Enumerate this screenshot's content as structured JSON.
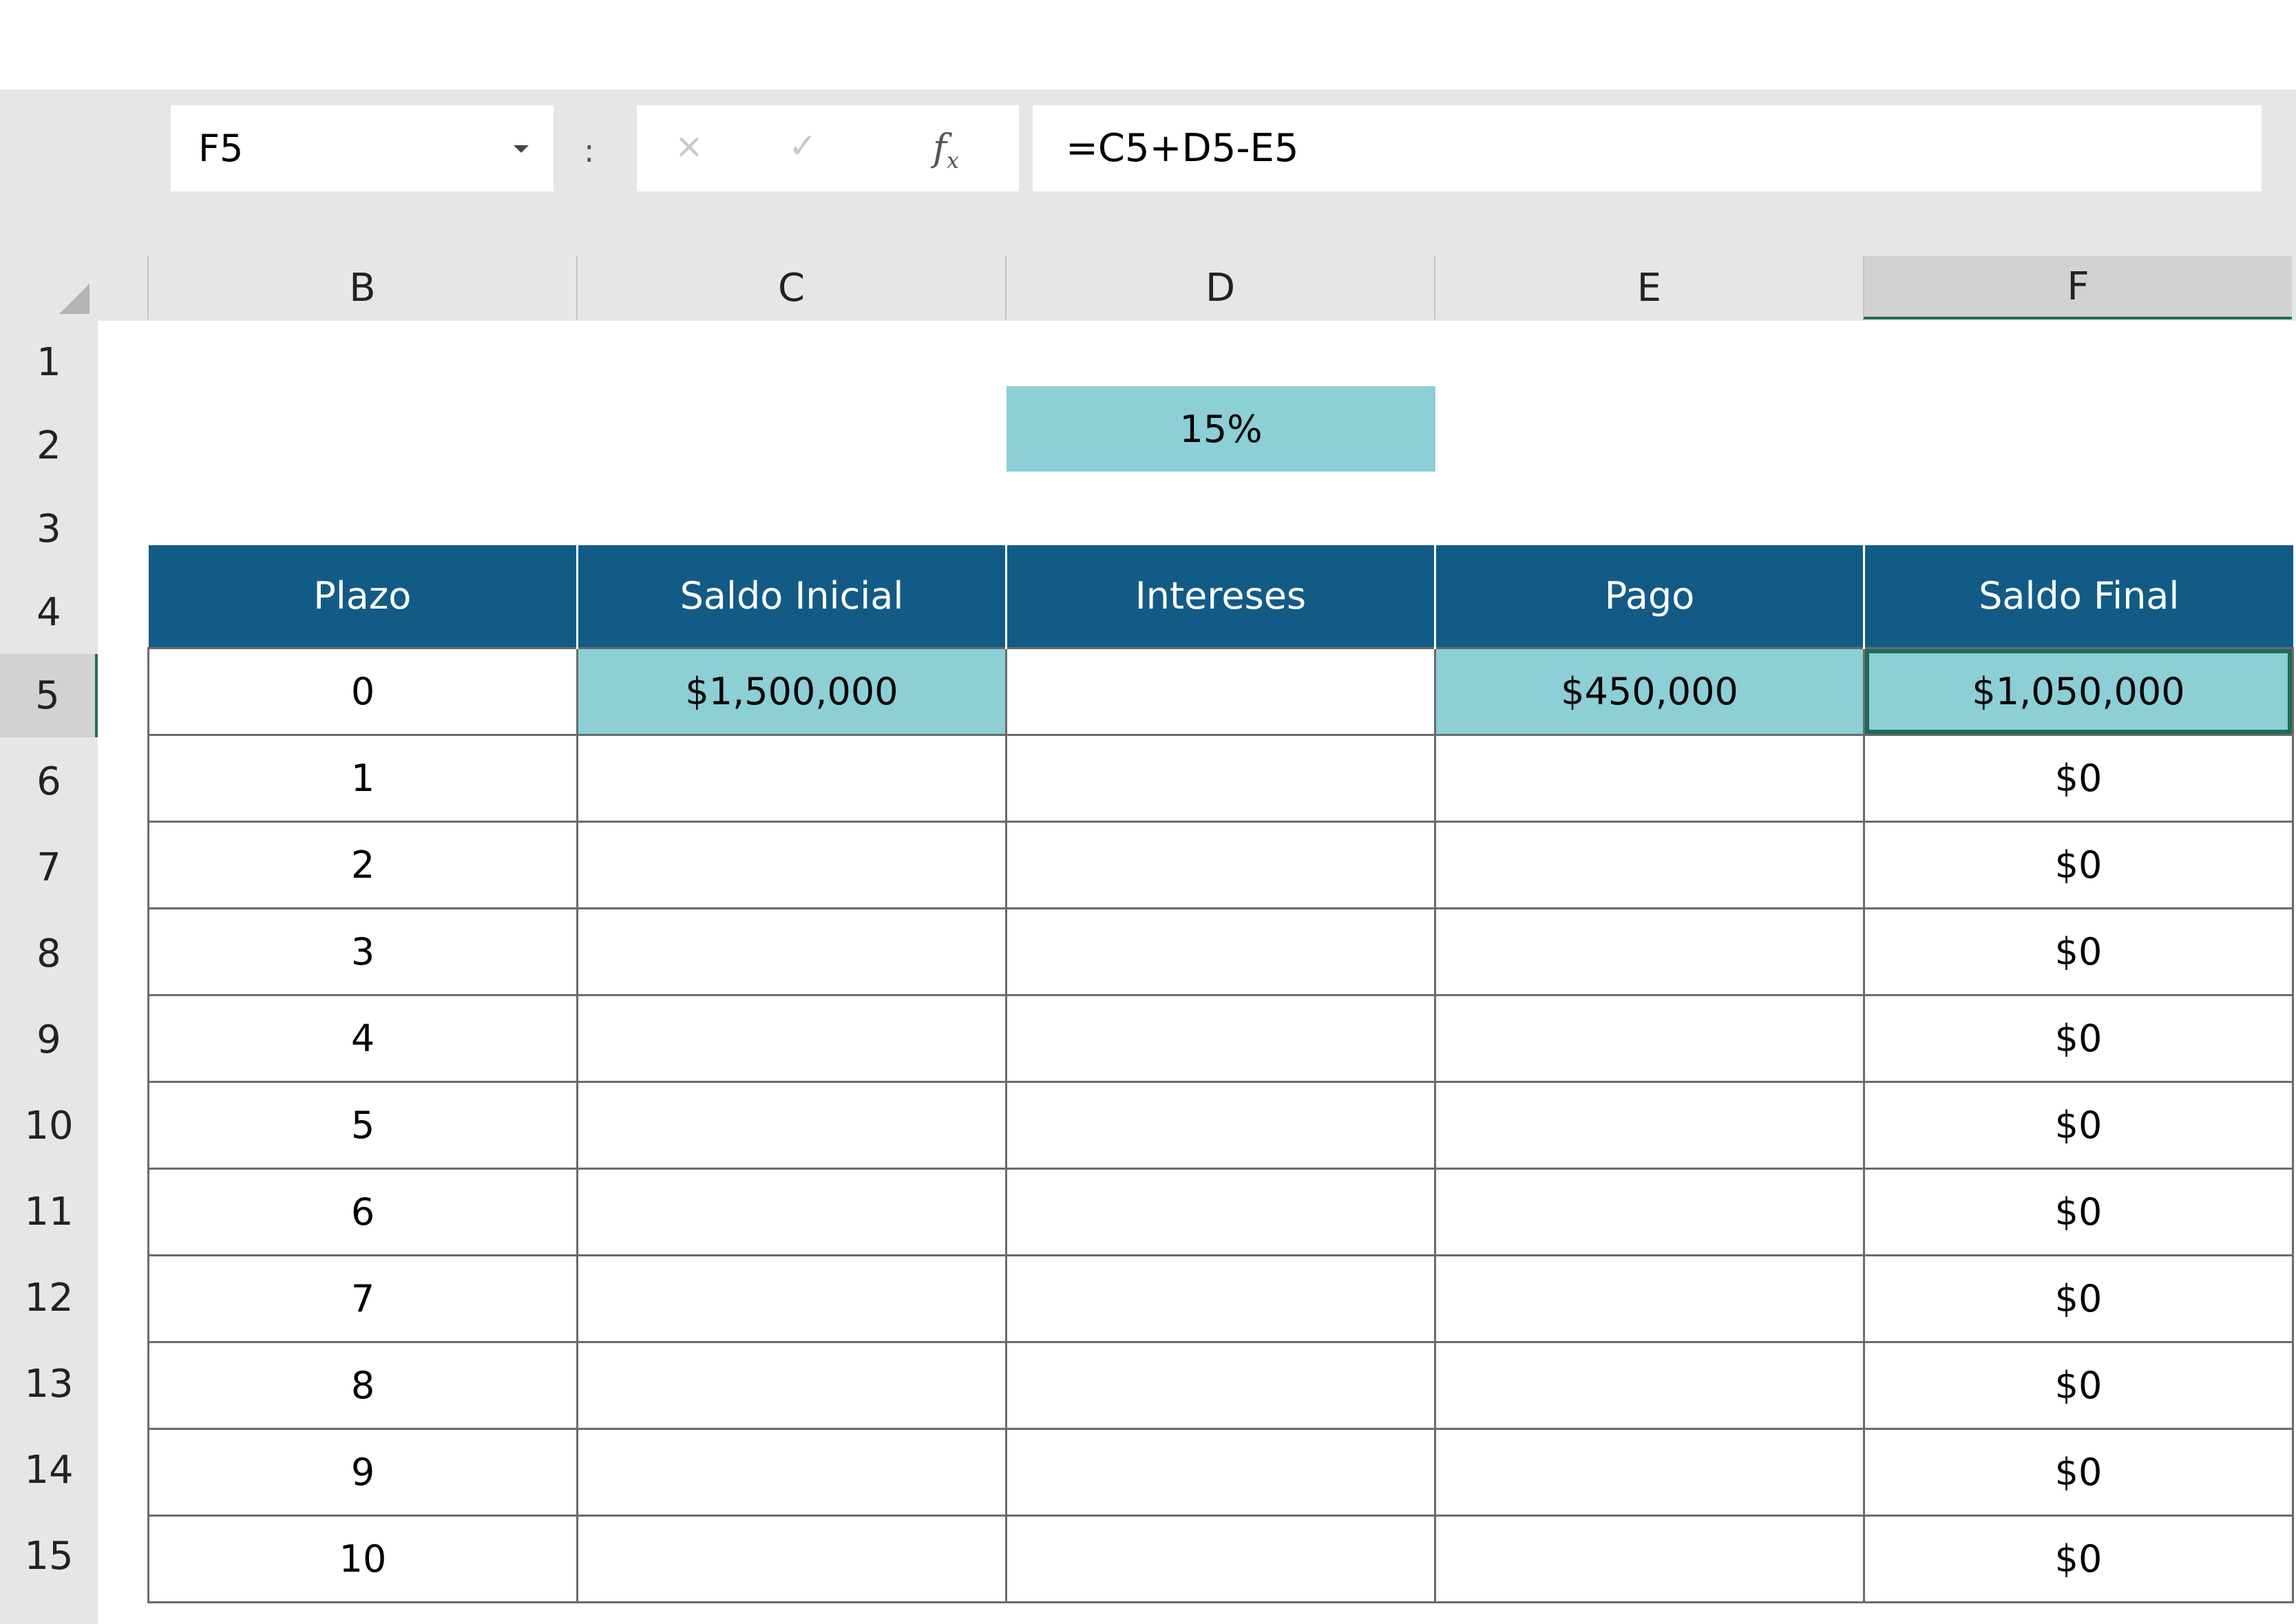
{
  "formula_bar": {
    "name_box": "F5",
    "separator": ":",
    "cancel_icon": "×",
    "enter_icon": "✓",
    "fx_label": "f",
    "fx_sub": "x",
    "formula": "=C5+D5-E5"
  },
  "columns": [
    "B",
    "C",
    "D",
    "E",
    "F"
  ],
  "selected_column": "F",
  "rows": [
    "1",
    "2",
    "3",
    "4",
    "5",
    "6",
    "7",
    "8",
    "9",
    "10",
    "11",
    "12",
    "13",
    "14",
    "15"
  ],
  "selected_row": "5",
  "rate_cell": "15%",
  "table": {
    "headers": [
      "Plazo",
      "Saldo Inicial",
      "Intereses",
      "Pago",
      "Saldo Final"
    ],
    "rows": [
      [
        "0",
        "$1,500,000",
        "",
        "$450,000",
        "$1,050,000"
      ],
      [
        "1",
        "",
        "",
        "",
        "$0"
      ],
      [
        "2",
        "",
        "",
        "",
        "$0"
      ],
      [
        "3",
        "",
        "",
        "",
        "$0"
      ],
      [
        "4",
        "",
        "",
        "",
        "$0"
      ],
      [
        "5",
        "",
        "",
        "",
        "$0"
      ],
      [
        "6",
        "",
        "",
        "",
        "$0"
      ],
      [
        "7",
        "",
        "",
        "",
        "$0"
      ],
      [
        "8",
        "",
        "",
        "",
        "$0"
      ],
      [
        "9",
        "",
        "",
        "",
        "$0"
      ],
      [
        "10",
        "",
        "",
        "",
        "$0"
      ]
    ]
  },
  "colors": {
    "header_fill": "#125b86",
    "input_fill": "#8ccfd6",
    "selection_border": "#1e6b5a"
  }
}
